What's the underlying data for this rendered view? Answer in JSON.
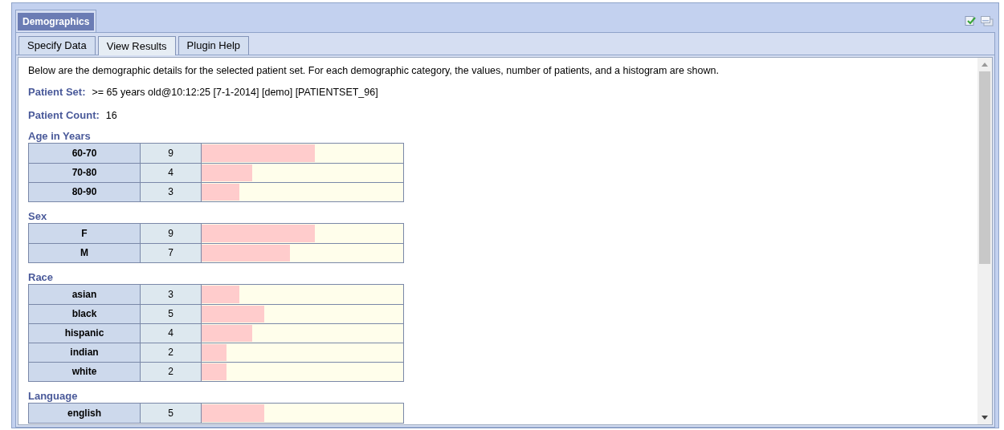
{
  "panel": {
    "title": "Demographics"
  },
  "tabs": [
    {
      "label": "Specify Data",
      "selected": false
    },
    {
      "label": "View Results",
      "selected": true
    },
    {
      "label": "Plugin Help",
      "selected": false
    }
  ],
  "intro": "Below are the demographic details for the selected patient set. For each demographic category, the values, number of patients, and a histogram are shown.",
  "patient_set": {
    "label": "Patient Set:",
    "value": ">= 65 years old@10:12:25 [7-1-2014] [demo] [PATIENTSET_96]"
  },
  "patient_count": {
    "label": "Patient Count:",
    "value": "16"
  },
  "sections": [
    {
      "title": "Age in Years",
      "rows": [
        {
          "label": "60-70",
          "count": "9",
          "level": 0.5625
        },
        {
          "label": "70-80",
          "count": "4",
          "level": 0.25
        },
        {
          "label": "80-90",
          "count": "3",
          "level": 0.1875
        }
      ]
    },
    {
      "title": "Sex",
      "rows": [
        {
          "label": "F",
          "count": "9",
          "level": 0.5625
        },
        {
          "label": "M",
          "count": "7",
          "level": 0.4375
        }
      ]
    },
    {
      "title": "Race",
      "rows": [
        {
          "label": "asian",
          "count": "3",
          "level": 0.1875
        },
        {
          "label": "black",
          "count": "5",
          "level": 0.3125
        },
        {
          "label": "hispanic",
          "count": "4",
          "level": 0.25
        },
        {
          "label": "indian",
          "count": "2",
          "level": 0.125
        },
        {
          "label": "white",
          "count": "2",
          "level": 0.125
        }
      ]
    },
    {
      "title": "Language",
      "rows": [
        {
          "label": "english",
          "count": "5",
          "level": 0.3125
        }
      ]
    }
  ]
}
